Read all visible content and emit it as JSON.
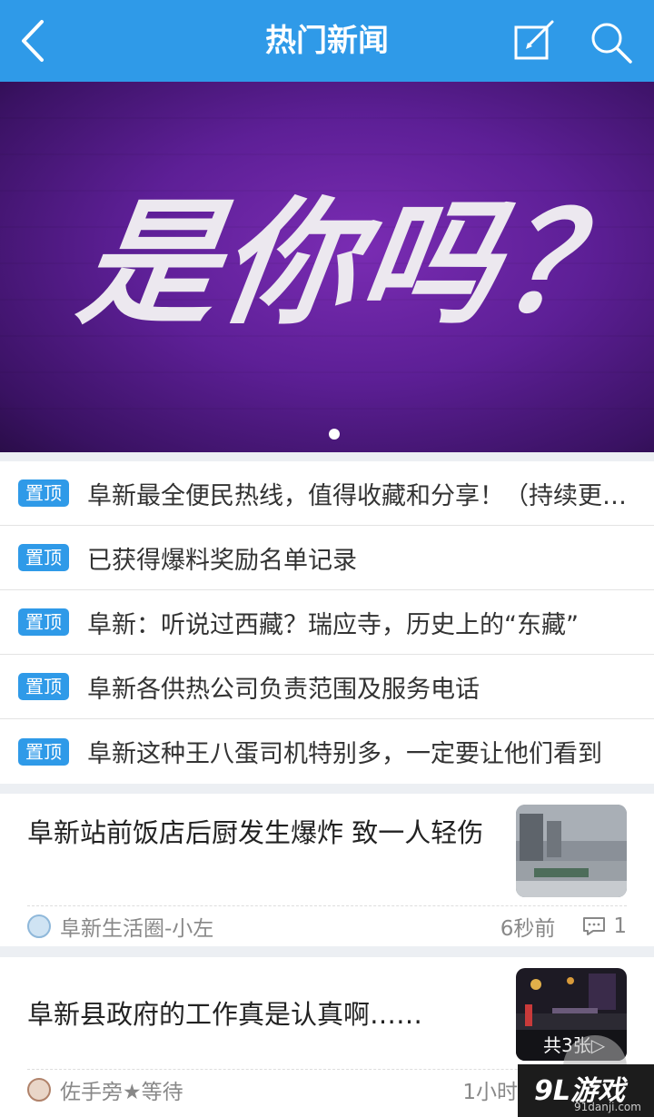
{
  "header": {
    "title": "热门新闻",
    "color": "#2f9ae8",
    "back_icon": "chevron-left-icon",
    "edit_icon": "edit-icon",
    "search_icon": "search-icon"
  },
  "banner": {
    "headline": "是你吗？",
    "slide_count": 1,
    "active_slide": 1
  },
  "pinned": {
    "tag_label": "置顶",
    "items": [
      "阜新最全便民热线，值得收藏和分享！（持续更新）",
      "已获得爆料奖励名单记录",
      "阜新：听说过西藏？瑞应寺，历史上的“东藏”",
      "阜新各供热公司负责范围及服务电话",
      "阜新这种王八蛋司机特别多，一定要让他们看到"
    ]
  },
  "news": [
    {
      "title": "阜新站前饭店后厨发生爆炸 致一人轻伤",
      "author": "阜新生活圈-小左",
      "time": "6秒前",
      "comments": "1"
    },
    {
      "title": "阜新县政府的工作真是认真啊……",
      "author": "佐手旁★等待",
      "time": "1小时",
      "photo_count": "共3张▷"
    }
  ],
  "watermark": {
    "logo": "9L游戏",
    "url": "91danji.com"
  }
}
